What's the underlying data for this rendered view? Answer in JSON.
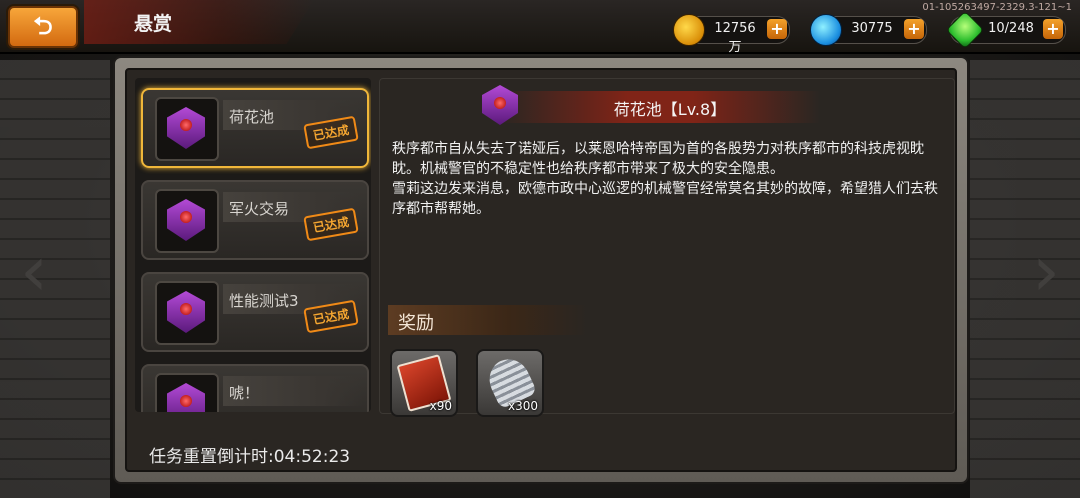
{
  "header": {
    "back_icon": "back-arrow-icon",
    "title": "悬赏",
    "version": "01-105263497-2329.3-121~1"
  },
  "resources": {
    "gold": {
      "value": "12756万",
      "icon": "gold-coin-icon"
    },
    "gems": {
      "value": "30775",
      "icon": "blue-gem-icon"
    },
    "energy": {
      "value": "10/248",
      "icon": "green-energy-icon"
    },
    "plus": "+"
  },
  "bounty_list": [
    {
      "name": "荷花池",
      "status": "已达成",
      "selected": true
    },
    {
      "name": "军火交易",
      "status": "已达成",
      "selected": false
    },
    {
      "name": "性能测试3",
      "status": "已达成",
      "selected": false
    },
    {
      "name": "唬！",
      "status": "",
      "selected": false
    }
  ],
  "detail": {
    "title": "荷花池【Lv.8】",
    "description_1": "秩序都市自从失去了诺娅后，以莱恩哈特帝国为首的各股势力对秩序都市的科技虎视眈眈。机械警官的不稳定性也给秩序都市带来了极大的安全隐患。",
    "description_2": "雪莉这边发来消息，欧德市政中心巡逻的机械警官经常莫名其妙的故障，希望猎人们去秩序都市帮帮她。",
    "reward_label": "奖励",
    "rewards": [
      {
        "icon": "red-ticket-icon",
        "qty": "x90"
      },
      {
        "icon": "silver-screw-icon",
        "qty": "x300"
      }
    ]
  },
  "footer": {
    "timer_text": "任务重置倒计时:04:52:23"
  },
  "colors": {
    "accent_orange": "#f0a22a",
    "selected_border": "#f0b73a",
    "title_red": "#96231a"
  }
}
